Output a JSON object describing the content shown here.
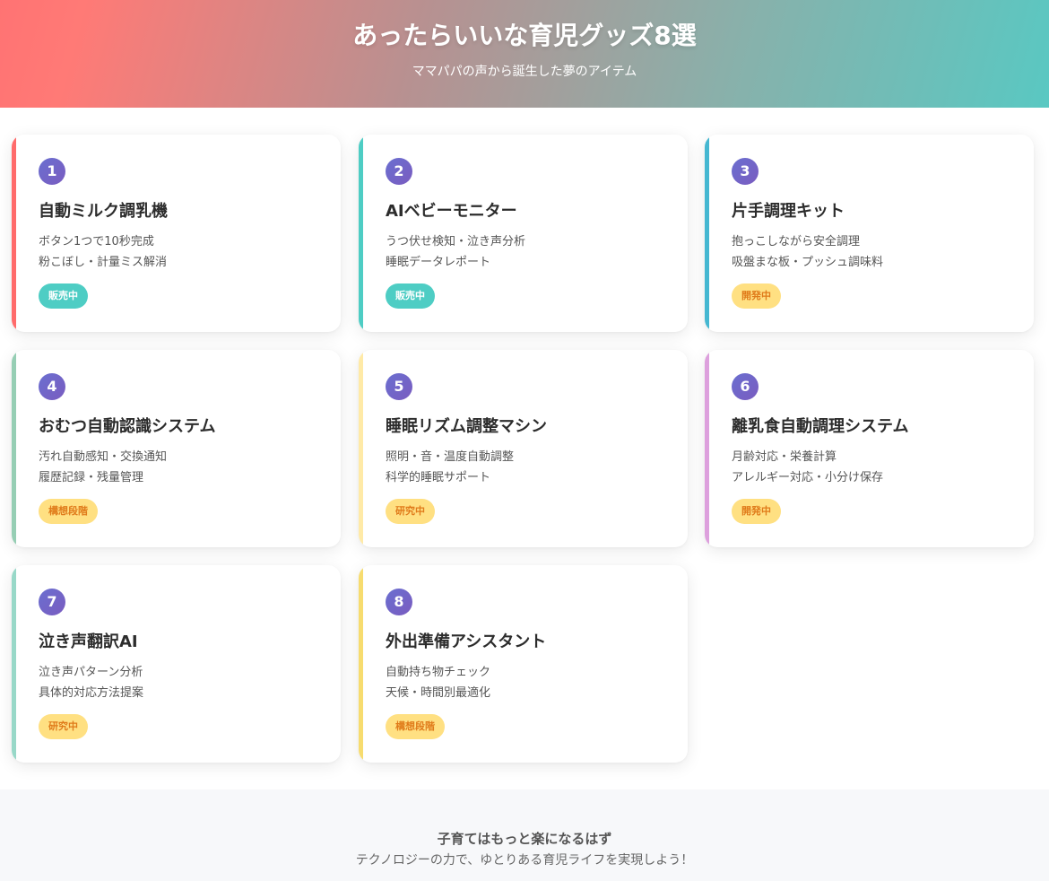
{
  "header": {
    "title": "あったらいいな育児グッズ8選",
    "subtitle": "ママパパの声から誕生した夢のアイテム"
  },
  "cards": [
    {
      "number": "1",
      "title": "自動ミルク調乳機",
      "desc1": "ボタン1つで10秒完成",
      "desc2": "粉こぼし・計量ミス解消",
      "status": "販売中",
      "status_type": "sale",
      "accent": "#ff6b6b"
    },
    {
      "number": "2",
      "title": "AIベビーモニター",
      "desc1": "うつ伏せ検知・泣き声分析",
      "desc2": "睡眠データレポート",
      "status": "販売中",
      "status_type": "sale",
      "accent": "#4ecdc4"
    },
    {
      "number": "3",
      "title": "片手調理キット",
      "desc1": "抱っこしながら安全調理",
      "desc2": "吸盤まな板・プッシュ調味料",
      "status": "開発中",
      "status_type": "dev",
      "accent": "#45b7d1"
    },
    {
      "number": "4",
      "title": "おむつ自動認識システム",
      "desc1": "汚れ自動感知・交換通知",
      "desc2": "履歴記録・残量管理",
      "status": "構想段階",
      "status_type": "dev",
      "accent": "#96ceb4"
    },
    {
      "number": "5",
      "title": "睡眠リズム調整マシン",
      "desc1": "照明・音・温度自動調整",
      "desc2": "科学的睡眠サポート",
      "status": "研究中",
      "status_type": "dev",
      "accent": "#ffeaa7"
    },
    {
      "number": "6",
      "title": "離乳食自動調理システム",
      "desc1": "月齢対応・栄養計算",
      "desc2": "アレルギー対応・小分け保存",
      "status": "開発中",
      "status_type": "dev",
      "accent": "#dda0dd"
    },
    {
      "number": "7",
      "title": "泣き声翻訳AI",
      "desc1": "泣き声パターン分析",
      "desc2": "具体的対応方法提案",
      "status": "研究中",
      "status_type": "dev",
      "accent": "#98d8c8"
    },
    {
      "number": "8",
      "title": "外出準備アシスタント",
      "desc1": "自動持ち物チェック",
      "desc2": "天候・時間別最適化",
      "status": "構想段階",
      "status_type": "dev",
      "accent": "#f7dc6f"
    }
  ],
  "footer": {
    "line1": "子育てはもっと楽になるはず",
    "line2": "テクノロジーの力で、ゆとりある育児ライフを実現しよう！"
  }
}
